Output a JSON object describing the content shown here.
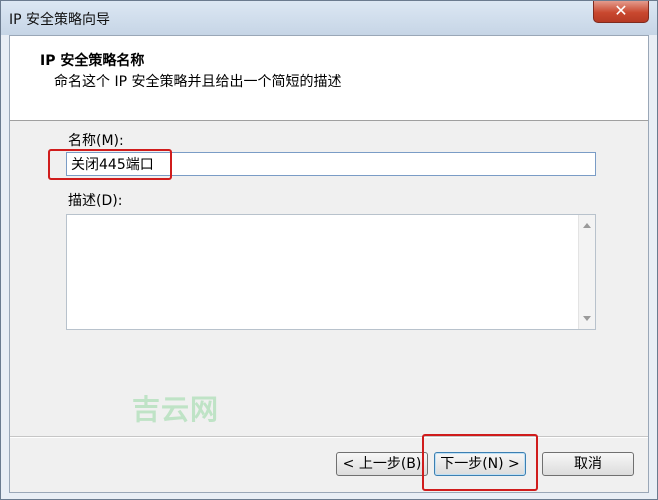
{
  "window": {
    "title": "IP 安全策略向导",
    "close_label": "✕"
  },
  "header": {
    "title": "IP 安全策略名称",
    "subtitle": "命名这个 IP 安全策略并且给出一个简短的描述"
  },
  "form": {
    "name_label": "名称(M):",
    "name_value": "关闭445端口",
    "description_label": "描述(D):",
    "description_value": ""
  },
  "watermark": "吉云网",
  "buttons": {
    "back": "< 上一步(B)",
    "next": "下一步(N) >",
    "cancel": "取消"
  },
  "colors": {
    "highlight": "#d01c1c",
    "close_button": "#c9482f",
    "watermark": "#bfe3c6"
  }
}
